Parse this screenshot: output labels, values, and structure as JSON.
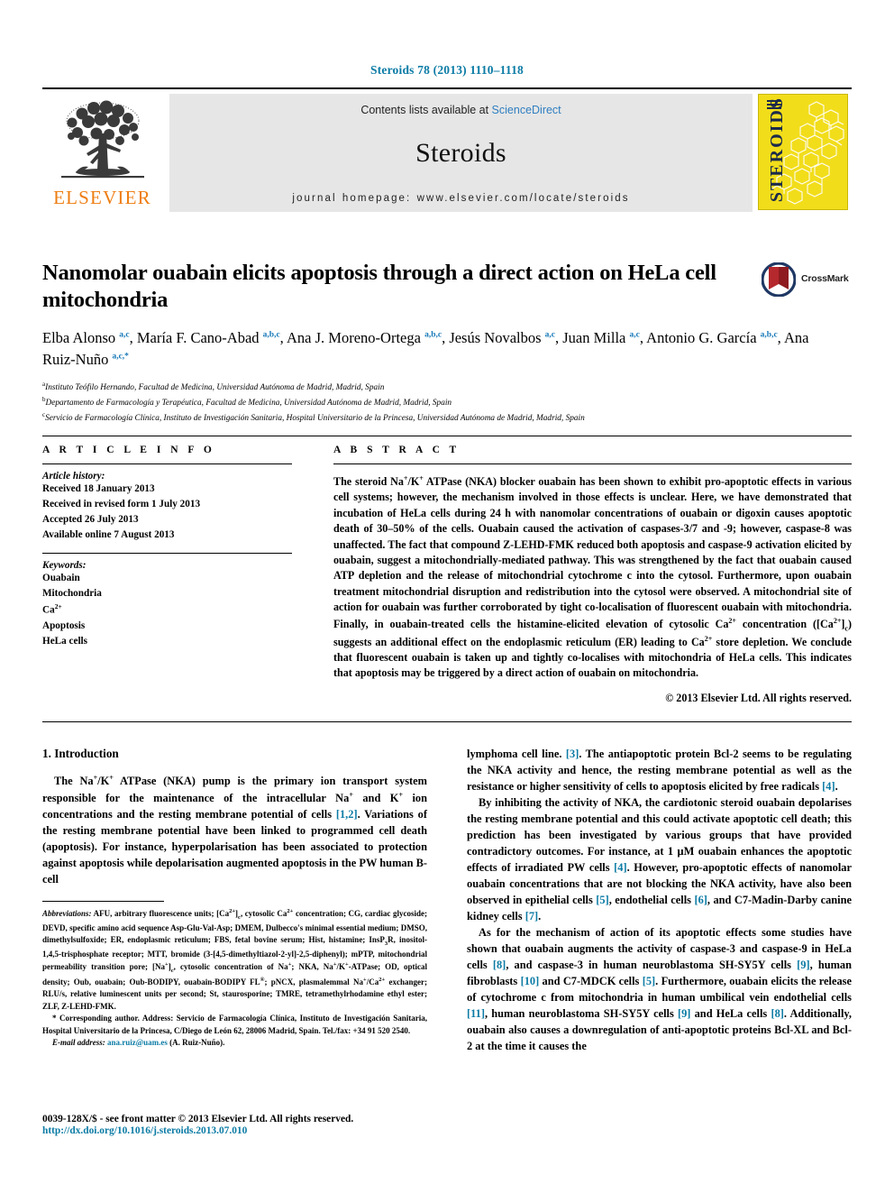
{
  "running_head": "Steroids 78 (2013) 1110–1118",
  "masthead": {
    "contents_prefix": "Contents lists available at ",
    "sciencedirect": "ScienceDirect",
    "journal_name": "Steroids",
    "homepage": "journal homepage: www.elsevier.com/locate/steroids",
    "publisher": "ELSEVIER",
    "cover_title": "STEROIDS",
    "accent_orange": "#ee7d11",
    "accent_blue": "#2f7fc1",
    "cover_yellow": "#f2dd1b"
  },
  "article": {
    "title": "Nanomolar ouabain elicits apoptosis through a direct action on HeLa cell mitochondria",
    "crossmark_label": "CrossMark",
    "authors_html": "Elba Alonso <sup>a,c</sup>, María F. Cano-Abad <sup>a,b,c</sup>, Ana J. Moreno-Ortega <sup>a,b,c</sup>, Jesús Novalbos <sup>a,c</sup>, Juan Milla <sup>a,c</sup>, Antonio G. García <sup>a,b,c</sup>, Ana Ruiz-Nuño <sup>a,c,*</sup>",
    "affiliations": [
      "Instituto Teófilo Hernando, Facultad de Medicina, Universidad Autónoma de Madrid, Madrid, Spain",
      "Departamento de Farmacología y Terapéutica, Facultad de Medicina, Universidad Autónoma de Madrid, Madrid, Spain",
      "Servicio de Farmacología Clínica, Instituto de Investigación Sanitaria, Hospital Universitario de la Princesa, Universidad Autónoma de Madrid, Madrid, Spain"
    ],
    "affiliation_marks": [
      "a",
      "b",
      "c"
    ]
  },
  "article_info": {
    "heading": "A R T I C L E   I N F O",
    "history_label": "Article history:",
    "history": [
      "Received 18 January 2013",
      "Received in revised form 1 July 2013",
      "Accepted 26 July 2013",
      "Available online 7 August 2013"
    ],
    "keywords_label": "Keywords:",
    "keywords_html": "Ouabain<br>Mitochondria<br>Ca<sup>2+</sup><br>Apoptosis<br>HeLa cells"
  },
  "abstract": {
    "heading": "A B S T R A C T",
    "text_html": "The steroid Na<sup>+</sup>/K<sup>+</sup> ATPase (NKA) blocker ouabain has been shown to exhibit pro-apoptotic effects in various cell systems; however, the mechanism involved in those effects is unclear. Here, we have demonstrated that incubation of HeLa cells during 24 h with nanomolar concentrations of ouabain or digoxin causes apoptotic death of 30–50% of the cells. Ouabain caused the activation of caspases-3/7 and -9; however, caspase-8 was unaffected. The fact that compound Z-LEHD-FMK reduced both apoptosis and caspase-9 activation elicited by ouabain, suggest a mitochondrially-mediated pathway. This was strengthened by the fact that ouabain caused ATP depletion and the release of mitochondrial cytochrome c into the cytosol. Furthermore, upon ouabain treatment mitochondrial disruption and redistribution into the cytosol were observed. A mitochondrial site of action for ouabain was further corroborated by tight co-localisation of fluorescent ouabain with mitochondria. Finally, in ouabain-treated cells the histamine-elicited elevation of cytosolic Ca<sup>2+</sup> concentration ([Ca<sup>2+</sup>]<sub>c</sub>) suggests an additional effect on the endoplasmic reticulum (ER) leading to Ca<sup>2+</sup> store depletion. We conclude that fluorescent ouabain is taken up and tightly co-localises with mitochondria of HeLa cells. This indicates that apoptosis may be triggered by a direct action of ouabain on mitochondria.",
    "copyright": "© 2013 Elsevier Ltd. All rights reserved."
  },
  "introduction": {
    "heading": "1. Introduction",
    "left_paragraph_html": "The Na<sup>+</sup>/K<sup>+</sup> ATPase (NKA) pump is the primary ion transport system responsible for the maintenance of the intracellular Na<sup>+</sup> and K<sup>+</sup> ion concentrations and the resting membrane potential of cells <span class=\"ref\">[1,2]</span>. Variations of the resting membrane potential have been linked to programmed cell death (apoptosis). For instance, hyperpolarisation has been associated to protection against apoptosis while depolarisation augmented apoptosis in the PW human B-cell",
    "right_paragraph_1_html": "lymphoma cell line. <span class=\"ref\">[3]</span>. The antiapoptotic protein Bcl-2 seems to be regulating the NKA activity and hence, the resting membrane potential as well as the resistance or higher sensitivity of cells to apoptosis elicited by free radicals <span class=\"ref\">[4]</span>.",
    "right_paragraph_2_html": "By inhibiting the activity of NKA, the cardiotonic steroid ouabain depolarises the resting membrane potential and this could activate apoptotic cell death; this prediction has been investigated by various groups that have provided contradictory outcomes. For instance, at 1 μM ouabain enhances the apoptotic effects of irradiated PW cells <span class=\"ref\">[4]</span>. However, pro-apoptotic effects of nanomolar ouabain concentrations that are not blocking the NKA activity, have also been observed in epithelial cells <span class=\"ref\">[5]</span>, endothelial cells <span class=\"ref\">[6]</span>, and C7-Madin-Darby canine kidney cells <span class=\"ref\">[7]</span>.",
    "right_paragraph_3_html": "As for the mechanism of action of its apoptotic effects some studies have shown that ouabain augments the activity of caspase-3 and caspase-9 in HeLa cells <span class=\"ref\">[8]</span>, and caspase-3 in human neuroblastoma SH-SY5Y cells <span class=\"ref\">[9]</span>, human fibroblasts <span class=\"ref\">[10]</span> and C7-MDCK cells <span class=\"ref\">[5]</span>. Furthermore, ouabain elicits the release of cytochrome c from mitochondria in human umbilical vein endothelial cells <span class=\"ref\">[11]</span>, human neuroblastoma SH-SY5Y cells <span class=\"ref\">[9]</span> and HeLa cells <span class=\"ref\">[8]</span>. Additionally, ouabain also causes a downregulation of anti-apoptotic proteins Bcl-XL and Bcl-2 at the time it causes the"
  },
  "footnotes": {
    "abbreviations_html": "<i>Abbreviations:</i> AFU, arbitrary fluorescence units; [Ca<sup>2+</sup>]<sub>c</sub>, cytosolic Ca<sup>2+</sup> concentration; CG, cardiac glycoside; DEVD, specific amino acid sequence Asp-Glu-Val-Asp; DMEM, Dulbecco's minimal essential medium; DMSO, dimethylsulfoxide; ER, endoplasmic reticulum; FBS, fetal bovine serum; Hist, histamine; InsP<sub>3</sub>R, inositol-1,4,5-trisphosphate receptor; MTT, bromide (3-[4,5-dimethyltiazol-2-yl]-2,5-diphenyl); mPTP, mitochondrial permeability transition pore; [Na<sup>+</sup>]<sub>c</sub>, cytosolic concentration of Na<sup>+</sup>; NKA, Na<sup>+</sup>/K<sup>+</sup>-ATPase; OD, optical density; Oub, ouabain; Oub-BODIPY, ouabain-BODIPY FL<sup>®</sup>; pNCX, plasmalemmal Na<sup>+</sup>/Ca<sup>2+</sup> exchanger; RLU/s, relative luminescent units per second; St, staurosporine; TMRE, tetramethylrhodamine ethyl ester; ZLF, Z-LEHD-FMK.",
    "corresponding_html": "* Corresponding author. Address: Servicio de Farmacología Clínica, Instituto de Investigación Sanitaria, Hospital Universitario de la Princesa, C/Diego de León 62, 28006 Madrid, Spain. Tel./fax: +34 91 520 2540.",
    "email_label": "E-mail address:",
    "email": "ana.ruiz@uam.es",
    "email_owner": "(A. Ruiz-Nuño)."
  },
  "footer": {
    "issn_line": "0039-128X/$ - see front matter © 2013 Elsevier Ltd. All rights reserved.",
    "doi": "http://dx.doi.org/10.1016/j.steroids.2013.07.010"
  }
}
